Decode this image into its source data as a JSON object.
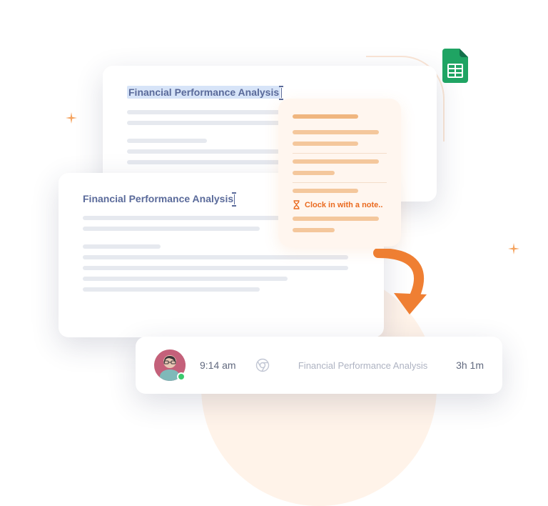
{
  "document": {
    "title": "Financial Performance Analysis"
  },
  "popup": {
    "clockin_label": "Clock in with a note.."
  },
  "time_entry": {
    "start_time": "9:14 am",
    "task": "Financial Performance Analysis",
    "duration": "3h 1m"
  },
  "colors": {
    "accent": "#ea6a1f",
    "sheets_green": "#1fa463"
  }
}
